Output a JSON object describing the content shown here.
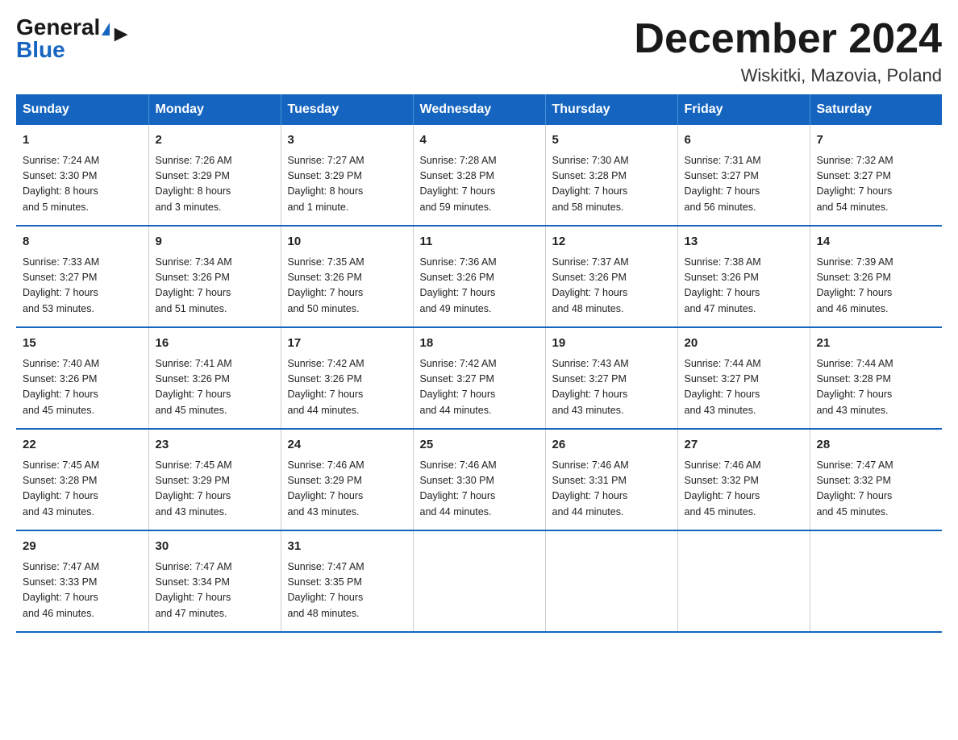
{
  "logo": {
    "general": "General",
    "triangle": "▶",
    "blue": "Blue"
  },
  "header": {
    "title": "December 2024",
    "location": "Wiskitki, Mazovia, Poland"
  },
  "weekdays": [
    "Sunday",
    "Monday",
    "Tuesday",
    "Wednesday",
    "Thursday",
    "Friday",
    "Saturday"
  ],
  "weeks": [
    [
      {
        "day": "1",
        "sunrise": "7:24 AM",
        "sunset": "3:30 PM",
        "daylight": "8 hours and 5 minutes."
      },
      {
        "day": "2",
        "sunrise": "7:26 AM",
        "sunset": "3:29 PM",
        "daylight": "8 hours and 3 minutes."
      },
      {
        "day": "3",
        "sunrise": "7:27 AM",
        "sunset": "3:29 PM",
        "daylight": "8 hours and 1 minute."
      },
      {
        "day": "4",
        "sunrise": "7:28 AM",
        "sunset": "3:28 PM",
        "daylight": "7 hours and 59 minutes."
      },
      {
        "day": "5",
        "sunrise": "7:30 AM",
        "sunset": "3:28 PM",
        "daylight": "7 hours and 58 minutes."
      },
      {
        "day": "6",
        "sunrise": "7:31 AM",
        "sunset": "3:27 PM",
        "daylight": "7 hours and 56 minutes."
      },
      {
        "day": "7",
        "sunrise": "7:32 AM",
        "sunset": "3:27 PM",
        "daylight": "7 hours and 54 minutes."
      }
    ],
    [
      {
        "day": "8",
        "sunrise": "7:33 AM",
        "sunset": "3:27 PM",
        "daylight": "7 hours and 53 minutes."
      },
      {
        "day": "9",
        "sunrise": "7:34 AM",
        "sunset": "3:26 PM",
        "daylight": "7 hours and 51 minutes."
      },
      {
        "day": "10",
        "sunrise": "7:35 AM",
        "sunset": "3:26 PM",
        "daylight": "7 hours and 50 minutes."
      },
      {
        "day": "11",
        "sunrise": "7:36 AM",
        "sunset": "3:26 PM",
        "daylight": "7 hours and 49 minutes."
      },
      {
        "day": "12",
        "sunrise": "7:37 AM",
        "sunset": "3:26 PM",
        "daylight": "7 hours and 48 minutes."
      },
      {
        "day": "13",
        "sunrise": "7:38 AM",
        "sunset": "3:26 PM",
        "daylight": "7 hours and 47 minutes."
      },
      {
        "day": "14",
        "sunrise": "7:39 AM",
        "sunset": "3:26 PM",
        "daylight": "7 hours and 46 minutes."
      }
    ],
    [
      {
        "day": "15",
        "sunrise": "7:40 AM",
        "sunset": "3:26 PM",
        "daylight": "7 hours and 45 minutes."
      },
      {
        "day": "16",
        "sunrise": "7:41 AM",
        "sunset": "3:26 PM",
        "daylight": "7 hours and 45 minutes."
      },
      {
        "day": "17",
        "sunrise": "7:42 AM",
        "sunset": "3:26 PM",
        "daylight": "7 hours and 44 minutes."
      },
      {
        "day": "18",
        "sunrise": "7:42 AM",
        "sunset": "3:27 PM",
        "daylight": "7 hours and 44 minutes."
      },
      {
        "day": "19",
        "sunrise": "7:43 AM",
        "sunset": "3:27 PM",
        "daylight": "7 hours and 43 minutes."
      },
      {
        "day": "20",
        "sunrise": "7:44 AM",
        "sunset": "3:27 PM",
        "daylight": "7 hours and 43 minutes."
      },
      {
        "day": "21",
        "sunrise": "7:44 AM",
        "sunset": "3:28 PM",
        "daylight": "7 hours and 43 minutes."
      }
    ],
    [
      {
        "day": "22",
        "sunrise": "7:45 AM",
        "sunset": "3:28 PM",
        "daylight": "7 hours and 43 minutes."
      },
      {
        "day": "23",
        "sunrise": "7:45 AM",
        "sunset": "3:29 PM",
        "daylight": "7 hours and 43 minutes."
      },
      {
        "day": "24",
        "sunrise": "7:46 AM",
        "sunset": "3:29 PM",
        "daylight": "7 hours and 43 minutes."
      },
      {
        "day": "25",
        "sunrise": "7:46 AM",
        "sunset": "3:30 PM",
        "daylight": "7 hours and 44 minutes."
      },
      {
        "day": "26",
        "sunrise": "7:46 AM",
        "sunset": "3:31 PM",
        "daylight": "7 hours and 44 minutes."
      },
      {
        "day": "27",
        "sunrise": "7:46 AM",
        "sunset": "3:32 PM",
        "daylight": "7 hours and 45 minutes."
      },
      {
        "day": "28",
        "sunrise": "7:47 AM",
        "sunset": "3:32 PM",
        "daylight": "7 hours and 45 minutes."
      }
    ],
    [
      {
        "day": "29",
        "sunrise": "7:47 AM",
        "sunset": "3:33 PM",
        "daylight": "7 hours and 46 minutes."
      },
      {
        "day": "30",
        "sunrise": "7:47 AM",
        "sunset": "3:34 PM",
        "daylight": "7 hours and 47 minutes."
      },
      {
        "day": "31",
        "sunrise": "7:47 AM",
        "sunset": "3:35 PM",
        "daylight": "7 hours and 48 minutes."
      },
      null,
      null,
      null,
      null
    ]
  ],
  "labels": {
    "sunrise": "Sunrise:",
    "sunset": "Sunset:",
    "daylight": "Daylight:"
  }
}
